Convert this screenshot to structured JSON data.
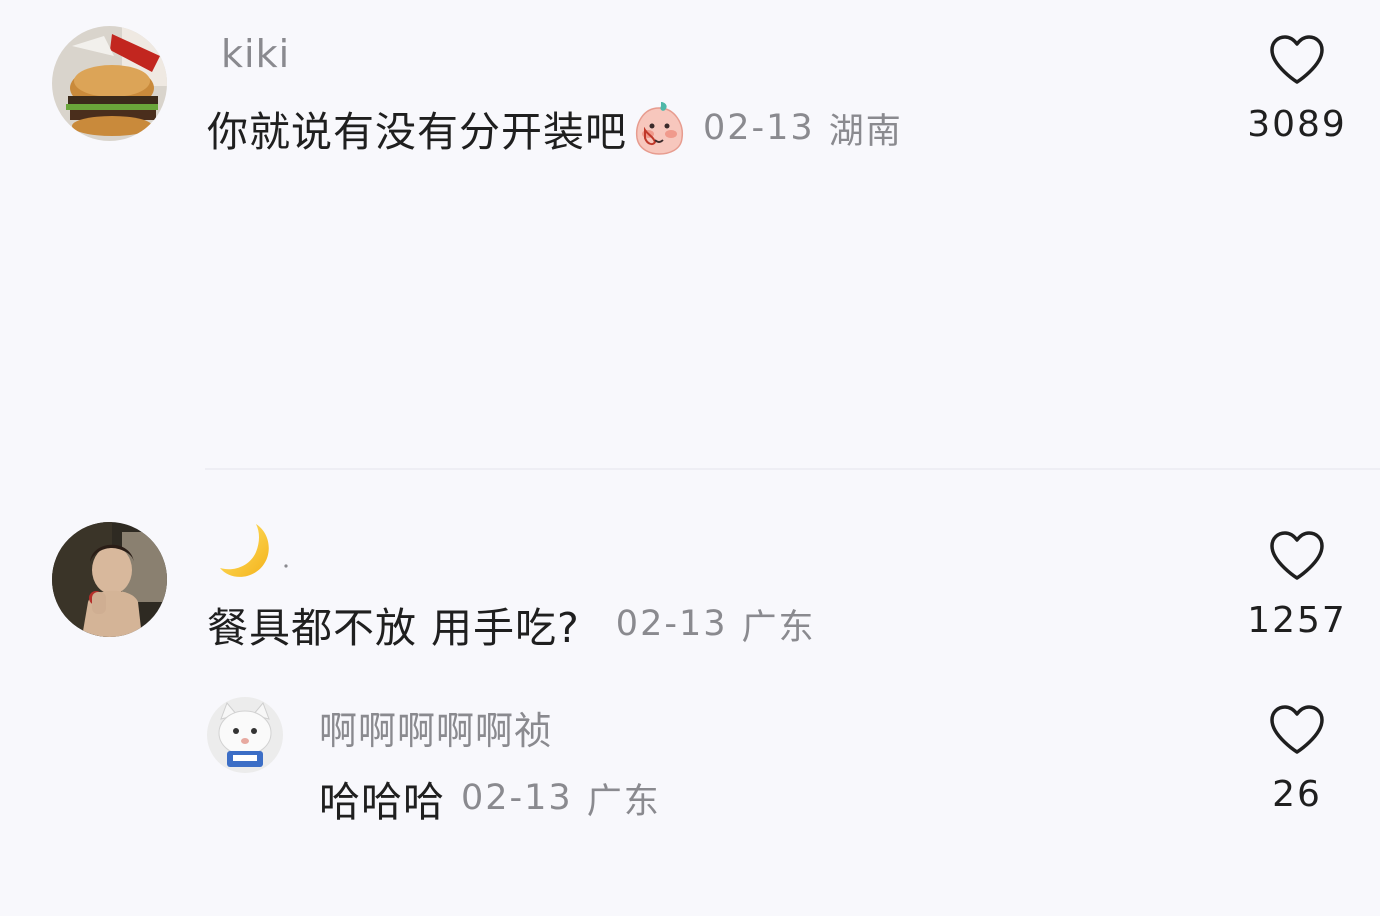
{
  "comments": [
    {
      "username": "kiki",
      "text": "你就说有没有分开装吧",
      "date": "02-13",
      "location": "湖南",
      "likes": "3089",
      "avatar_icon": "burger-avatar",
      "text_emoji": "blushing-peach-emoji"
    },
    {
      "username": "",
      "username_icon": "crescent-moon-icon",
      "text": "餐具都不放 用手吃?",
      "date": "02-13",
      "location": "广东",
      "likes": "1257",
      "avatar_icon": "person-eating-avatar",
      "replies": [
        {
          "username": "啊啊啊啊啊祯",
          "text": "哈哈哈",
          "date": "02-13",
          "location": "广东",
          "likes": "26",
          "avatar_icon": "white-cat-avatar"
        }
      ]
    }
  ],
  "colors": {
    "background": "#f8f8fc",
    "primary_text": "#1f1f1f",
    "secondary_text": "#8a8a8f",
    "heart_outline": "#1f1f1f"
  }
}
